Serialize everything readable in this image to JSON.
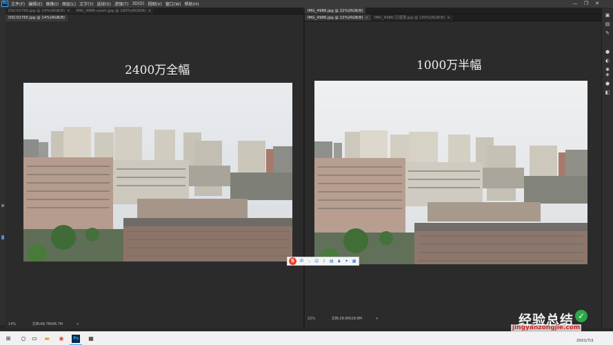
{
  "app": {
    "logo_text": "Ps",
    "menu": [
      "文件(F)",
      "编辑(E)",
      "图像(I)",
      "图层(L)",
      "文字(Y)",
      "选择(S)",
      "滤镜(T)",
      "3D(D)",
      "视图(V)",
      "窗口(W)",
      "帮助(H)"
    ],
    "window_controls": {
      "minimize": "—",
      "restore": "❐",
      "close": "✕"
    }
  },
  "left_doc": {
    "tabs": [
      {
        "label": "DSC02765.jpg @ 14%(RGB/8)",
        "close": "×"
      },
      {
        "label": "IMG_4986-zoom.jpg @ 100%(RGB/8)",
        "close": "×"
      }
    ],
    "doc_tab": "DSC02765.jpg @ 14%(RGB/8)",
    "title": "2400万全幅",
    "zoom": "14%",
    "doc_size": "文档:68.7M/68.7M",
    "arrow": ">"
  },
  "right_doc": {
    "tabs": [
      {
        "label": "IMG_4986.jpg @ 22%(RGB/8)",
        "close": "×"
      },
      {
        "label": "IMG_4986-已增强.jpg @ 100%(RGB/8)",
        "close": "×"
      }
    ],
    "panel_label": "IMG_4986.jpg @ 22%(RGB/8)",
    "title": "1000万半幅",
    "zoom": "22%",
    "doc_size": "文档:28.8M/28.8M",
    "arrow": ">"
  },
  "ime": {
    "logo": "S",
    "icons": [
      "中",
      "·,",
      "☺",
      "♪",
      "▤",
      "♟",
      "✦",
      "▦"
    ]
  },
  "taskbar": {
    "time": "",
    "date": "2021/7/2"
  },
  "watermark": {
    "title": "经验总结",
    "check": "✓",
    "url": "jingyanzongjie.com"
  },
  "colors": {
    "accent": "#31a8ff",
    "background": "#262626"
  }
}
